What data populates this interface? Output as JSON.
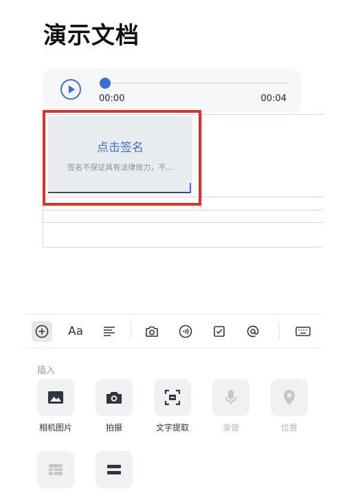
{
  "doc": {
    "title": "演示文档"
  },
  "audio": {
    "current_time": "00:00",
    "duration": "00:04",
    "progress": 0.0
  },
  "signature": {
    "prompt": "点击签名",
    "disclaimer": "签名不保证具有法律效力，不..."
  },
  "toolbar": {
    "icons": [
      "plus-icon",
      "font-icon",
      "align-left-icon",
      "camera-icon",
      "audio-icon",
      "checkbox-icon",
      "at-icon",
      "keyboard-icon"
    ],
    "text_icon_glyph": "Aa"
  },
  "insert_panel": {
    "label": "插入",
    "items": [
      {
        "label": "相机图片",
        "icon": "image-icon",
        "enabled": true
      },
      {
        "label": "拍摄",
        "icon": "camera-icon",
        "enabled": true
      },
      {
        "label": "文字提取",
        "icon": "text-scan-icon",
        "enabled": true
      },
      {
        "label": "录音",
        "icon": "microphone-icon",
        "enabled": false
      },
      {
        "label": "位置",
        "icon": "location-icon",
        "enabled": false
      }
    ],
    "row2": [
      {
        "icon": "table-icon",
        "enabled": false
      },
      {
        "icon": "divider-icon",
        "enabled": true
      }
    ]
  },
  "colors": {
    "accent": "#3d6fd0",
    "highlight": "#d9322a",
    "muted": "#b4b7bb"
  }
}
